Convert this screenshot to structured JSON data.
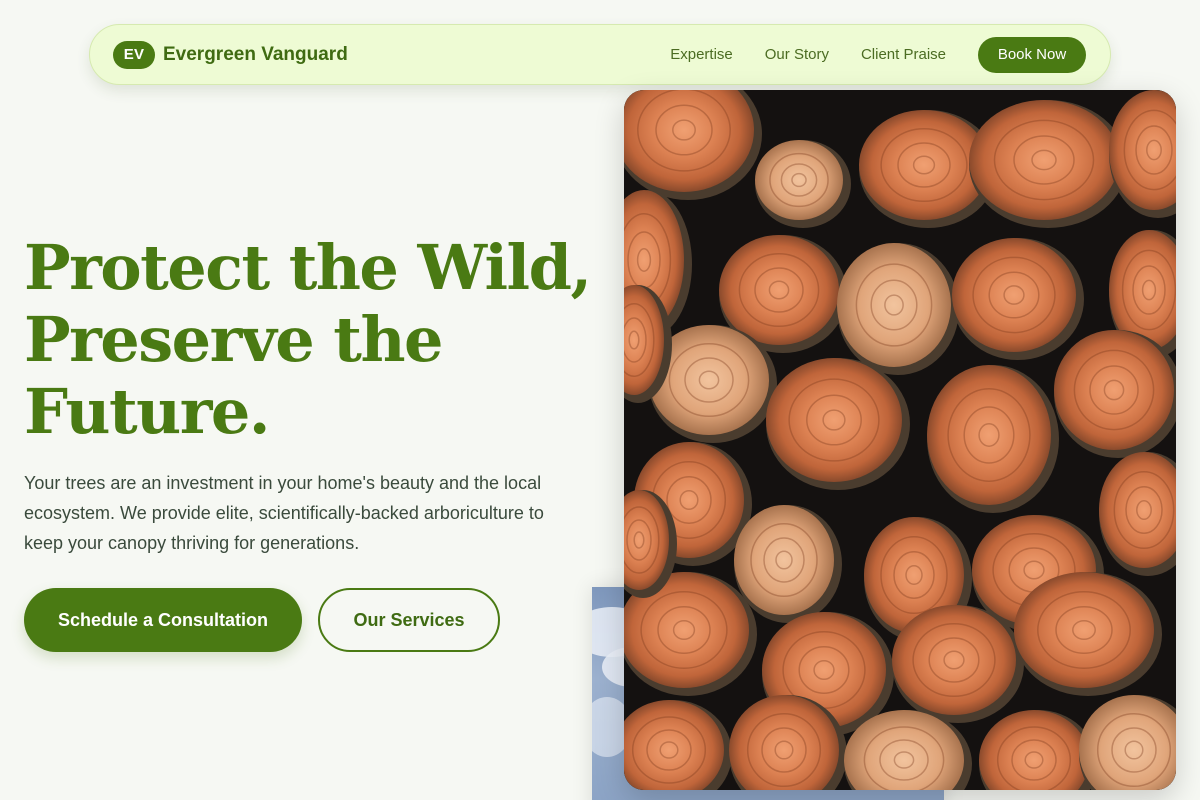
{
  "nav": {
    "logo_initials": "EV",
    "brand_name": "Evergreen Vanguard",
    "links": [
      "Expertise",
      "Our Story",
      "Client Praise"
    ],
    "cta_label": "Book Now"
  },
  "hero": {
    "title": "Protect the Wild, Preserve the Future.",
    "description": "Your trees are an investment in your home's beauty and the local ecosystem. We provide elite, scientifically-backed arboriculture to keep your canopy thriving for generations.",
    "primary_cta": "Schedule a Consultation",
    "secondary_cta": "Our Services"
  },
  "images": {
    "main": "stacked-cut-logs-photo",
    "secondary": "sky-with-clouds-photo"
  },
  "colors": {
    "brand_green": "#4a7a13",
    "nav_background": "#eefbd4",
    "page_background": "#f6f8f3",
    "body_text": "#3a4a3c"
  }
}
